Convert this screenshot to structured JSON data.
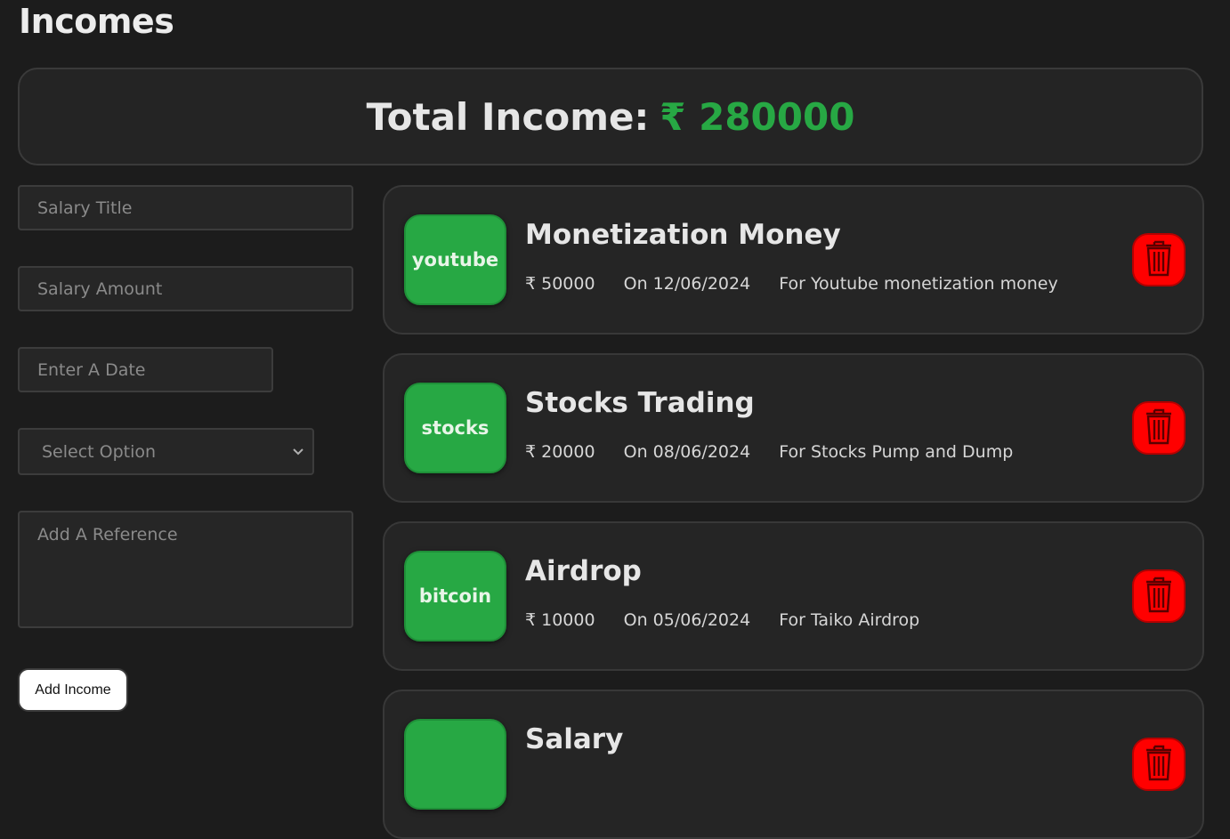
{
  "page": {
    "title": "Incomes"
  },
  "total": {
    "label": "Total Income:",
    "value": "₹ 280000"
  },
  "form": {
    "title_placeholder": "Salary Title",
    "amount_placeholder": "Salary Amount",
    "date_placeholder": "Enter A Date",
    "select_value": "Select Option",
    "reference_placeholder": "Add A Reference",
    "add_button": "Add Income"
  },
  "incomes": [
    {
      "category": "youtube",
      "title": "Monetization Money",
      "amount": "₹ 50000",
      "date": "On 12/06/2024",
      "reference": "For Youtube monetization money"
    },
    {
      "category": "stocks",
      "title": "Stocks Trading",
      "amount": "₹ 20000",
      "date": "On 08/06/2024",
      "reference": "For Stocks Pump and Dump"
    },
    {
      "category": "bitcoin",
      "title": "Airdrop",
      "amount": "₹ 10000",
      "date": "On 05/06/2024",
      "reference": "For Taiko Airdrop"
    },
    {
      "category": "",
      "title": "Salary",
      "amount": "",
      "date": "",
      "reference": ""
    }
  ],
  "colors": {
    "accent": "#27a844",
    "delete": "#ff0000",
    "background": "#1c1c1c"
  },
  "icons": {
    "delete": "trash-icon"
  }
}
